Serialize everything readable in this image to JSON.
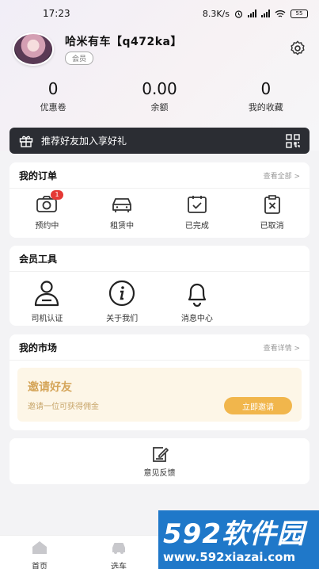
{
  "status_bar": {
    "time": "17:23",
    "net_speed": "8.3K/s",
    "battery": "55"
  },
  "profile": {
    "username": "哈米有车【q472ka】",
    "member_badge": "会员"
  },
  "stats": [
    {
      "value": "0",
      "label": "优惠卷"
    },
    {
      "value": "0.00",
      "label": "余额"
    },
    {
      "value": "0",
      "label": "我的收藏"
    }
  ],
  "invite_banner": {
    "text": "推荐好友加入享好礼"
  },
  "orders": {
    "title": "我的订单",
    "more": "查看全部 >",
    "items": [
      {
        "label": "预约中",
        "icon": "camera-icon",
        "badge": "1"
      },
      {
        "label": "租赁中",
        "icon": "car-icon"
      },
      {
        "label": "已完成",
        "icon": "calendar-check-icon"
      },
      {
        "label": "已取消",
        "icon": "clipboard-x-icon"
      }
    ]
  },
  "tools": {
    "title": "会员工具",
    "items": [
      {
        "label": "司机认证",
        "icon": "driver-icon"
      },
      {
        "label": "关于我们",
        "icon": "info-icon"
      },
      {
        "label": "消息中心",
        "icon": "bell-icon"
      }
    ]
  },
  "market": {
    "title": "我的市场",
    "more": "查看详情 >",
    "invite_title": "邀请好友",
    "invite_sub": "邀请一位可获得佣金",
    "invite_button": "立即邀请"
  },
  "feedback": {
    "label": "意见反馈"
  },
  "tabbar": [
    {
      "label": "首页",
      "icon": "home-icon"
    },
    {
      "label": "选车",
      "icon": "car-icon"
    }
  ],
  "watermark": {
    "logo": "592软件园",
    "url": "www.592xiazai.com"
  },
  "colors": {
    "accent_gold": "#f1b64c",
    "banner_dark": "#2b2d33",
    "badge_red": "#e53935"
  }
}
